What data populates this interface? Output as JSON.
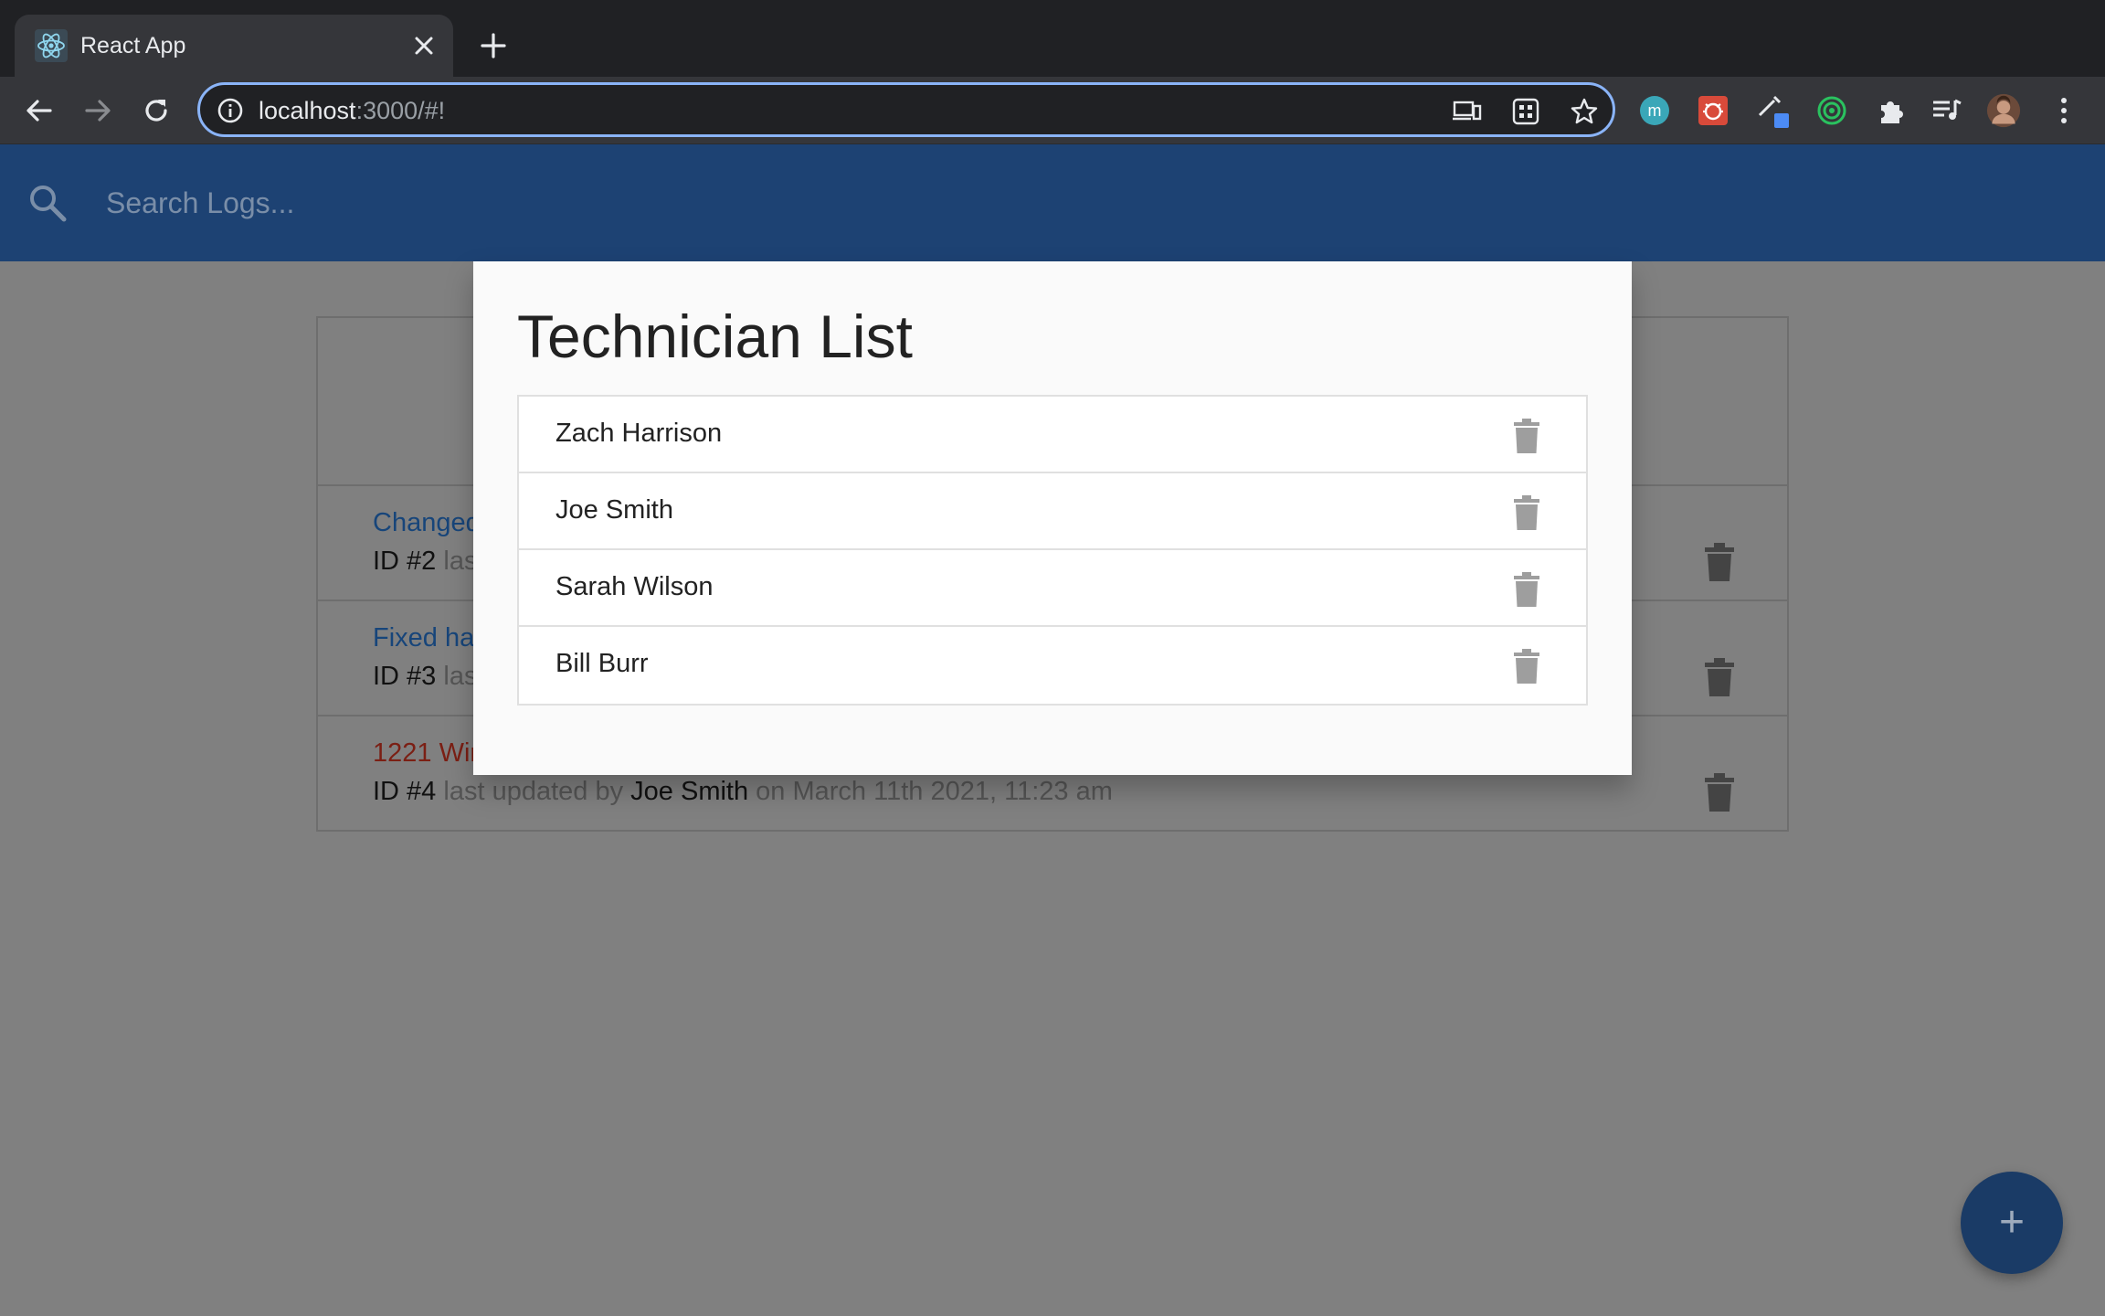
{
  "browser": {
    "tab_title": "React App",
    "url_host": "localhost",
    "url_rest": ":3000/#!"
  },
  "search": {
    "placeholder": "Search Logs..."
  },
  "logs": [
    {
      "message": "Changed",
      "id": "ID #2",
      "meta_text": "las"
    },
    {
      "message": "Fixed ha",
      "id": "ID #3",
      "meta_text": "las"
    },
    {
      "message": "1221 Wir",
      "id": "ID #4",
      "updated_prefix": "last updated by",
      "tech": "Joe Smith",
      "date_text": "on March 11th 2021, 11:23 am",
      "attention": true
    }
  ],
  "modal": {
    "title": "Technician List",
    "technicians": [
      {
        "name": "Zach Harrison"
      },
      {
        "name": "Joe Smith"
      },
      {
        "name": "Sarah Wilson"
      },
      {
        "name": "Bill Burr"
      }
    ]
  },
  "fab": {
    "label": "+"
  },
  "colors": {
    "header_blue": "#1d4273",
    "link_blue": "#17457a",
    "attention_red": "#7b1f14",
    "overlay": "#808080"
  },
  "icons": {
    "search": "search-icon",
    "delete": "trash-icon",
    "add": "plus-icon"
  }
}
